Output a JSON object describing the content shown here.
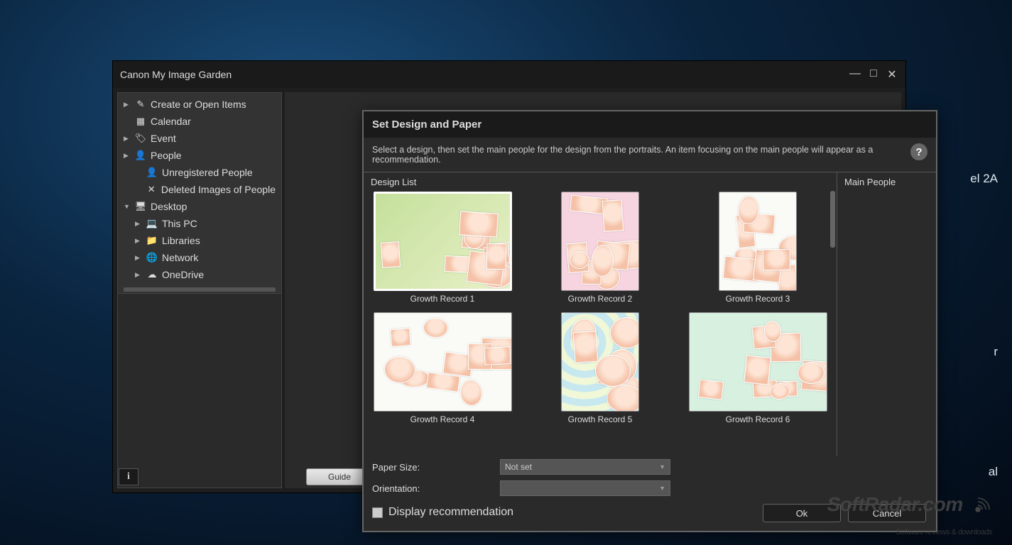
{
  "main_window": {
    "title": "Canon My Image Garden"
  },
  "sidebar": {
    "items": [
      {
        "arrow": "▶",
        "icon": "✎",
        "label": "Create or Open Items",
        "indent": 0
      },
      {
        "arrow": "",
        "icon": "▦",
        "label": "Calendar",
        "indent": 0
      },
      {
        "arrow": "▶",
        "icon": "🏷",
        "label": "Event",
        "indent": 0
      },
      {
        "arrow": "▶",
        "icon": "👤",
        "label": "People",
        "indent": 0
      },
      {
        "arrow": "",
        "icon": "👤",
        "label": "Unregistered People",
        "indent": 1
      },
      {
        "arrow": "",
        "icon": "✕",
        "label": "Deleted Images of People",
        "indent": 1
      },
      {
        "arrow": "▼",
        "icon": "🖥",
        "label": "Desktop",
        "indent": 0
      },
      {
        "arrow": "▶",
        "icon": "💻",
        "label": "This PC",
        "indent": 1
      },
      {
        "arrow": "▶",
        "icon": "📁",
        "label": "Libraries",
        "indent": 1
      },
      {
        "arrow": "▶",
        "icon": "🌐",
        "label": "Network",
        "indent": 1
      },
      {
        "arrow": "▶",
        "icon": "☁",
        "label": "OneDrive",
        "indent": 1
      }
    ]
  },
  "bottom_bar": {
    "info_label": "i",
    "guide_label": "Guide"
  },
  "dialog": {
    "title": "Set Design and Paper",
    "description": "Select a design, then set the main people for the design from the portraits. An item focusing on the main people will appear as a recommendation.",
    "design_list_label": "Design List",
    "main_people_label": "Main People",
    "designs": [
      {
        "label": "Growth Record 1",
        "selected": true,
        "shape": "landscape",
        "bg": "t-green"
      },
      {
        "label": "Growth Record 2",
        "selected": false,
        "shape": "portrait",
        "bg": "t-pink"
      },
      {
        "label": "Growth Record 3",
        "selected": false,
        "shape": "portrait",
        "bg": "t-white"
      },
      {
        "label": "Growth Record 4",
        "selected": false,
        "shape": "landscape",
        "bg": "t-white"
      },
      {
        "label": "Growth Record 5",
        "selected": false,
        "shape": "portrait",
        "bg": "t-blue"
      },
      {
        "label": "Growth Record 6",
        "selected": false,
        "shape": "landscape",
        "bg": "t-mint"
      }
    ],
    "paper_size_label": "Paper Size:",
    "paper_size_value": "Not set",
    "orientation_label": "Orientation:",
    "orientation_value": "",
    "display_recommendation_label": "Display recommendation",
    "ok_label": "Ok",
    "cancel_label": "Cancel"
  },
  "watermark": {
    "main": "SoftRadar.com",
    "sub": "Software reviews & downloads"
  },
  "bg_labels": {
    "a": "el 2A",
    "b": "r",
    "c": "al"
  }
}
